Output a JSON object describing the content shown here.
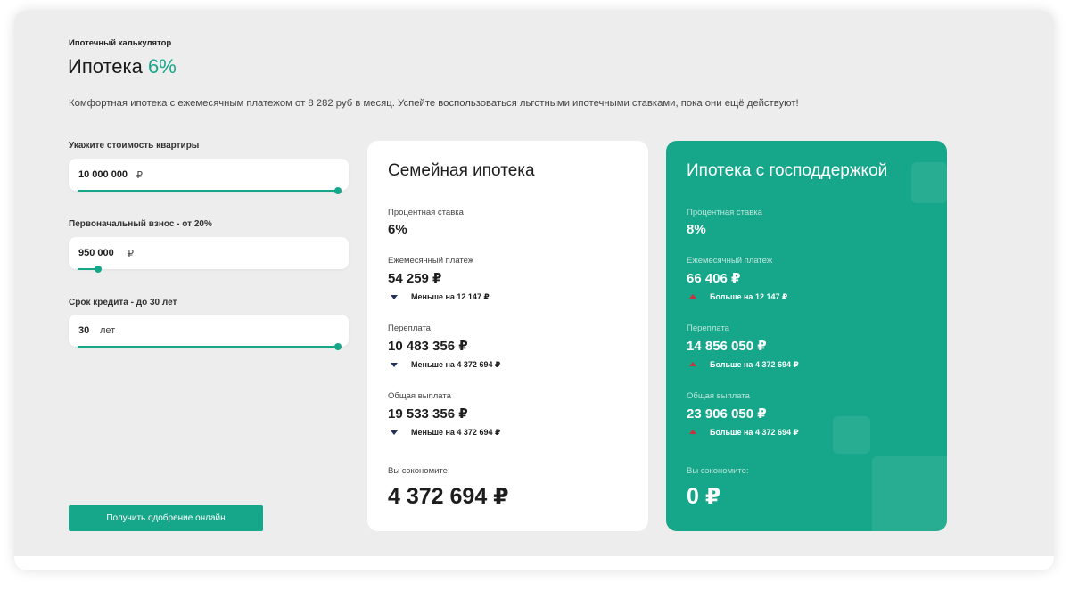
{
  "header": {
    "breadcrumb": "Ипотечный калькулятор",
    "title_prefix": "Ипотека",
    "title_accent": "6%",
    "promo": "Комфортная ипотека с ежемесячным платежом от 8 282 руб в месяц. Успейте воспользоваться льготными ипотечными ставками, пока они ещё действуют!"
  },
  "inputs": {
    "price": {
      "label": "Укажите стоимость квартиры",
      "value": "10 000 000",
      "unit": "₽",
      "slider_fraction": 1.0
    },
    "down_payment": {
      "label": "Первоначальный взнос - от 20%",
      "value": "950 000",
      "unit": "₽",
      "slider_fraction": 0.08
    },
    "term": {
      "label": "Срок кредита - до 30 лет",
      "value": "30",
      "unit": "лет",
      "slider_fraction": 1.0
    }
  },
  "cta": {
    "label": "Получить одобрение онлайн"
  },
  "cards": {
    "family": {
      "title": "Семейная ипотека",
      "rate_label": "Процентная ставка",
      "rate": "6%",
      "monthly_label": "Ежемесячный платеж",
      "monthly": "54 259 ₽",
      "monthly_delta": "Меньше на 12 147 ₽",
      "overpay_label": "Переплата",
      "overpay": "10 483 356 ₽",
      "overpay_delta": "Меньше на 4 372 694 ₽",
      "total_label": "Общая выплата",
      "total": "19 533 356 ₽",
      "total_delta": "Меньше на 4 372 694 ₽",
      "savings_label": "Вы сэкономите:",
      "savings": "4 372 694 ₽"
    },
    "state": {
      "title": "Ипотека с господдержкой",
      "rate_label": "Процентная ставка",
      "rate": "8%",
      "monthly_label": "Ежемесячный платеж",
      "monthly": "66 406 ₽",
      "monthly_delta": "Больше на 12 147 ₽",
      "overpay_label": "Переплата",
      "overpay": "14 856 050 ₽",
      "overpay_delta": "Больше на 4 372 694 ₽",
      "total_label": "Общая выплата",
      "total": "23 906 050 ₽",
      "total_delta": "Больше на 4 372 694 ₽",
      "savings_label": "Вы сэкономите:",
      "savings": "0 ₽"
    }
  },
  "colors": {
    "accent": "#16a78a",
    "background": "#ededed",
    "card_white": "#ffffff",
    "arrow_down": "#21325b",
    "arrow_up": "#c8323c"
  },
  "icons": {
    "decrease": "triangle-down-icon",
    "increase": "triangle-up-icon"
  }
}
